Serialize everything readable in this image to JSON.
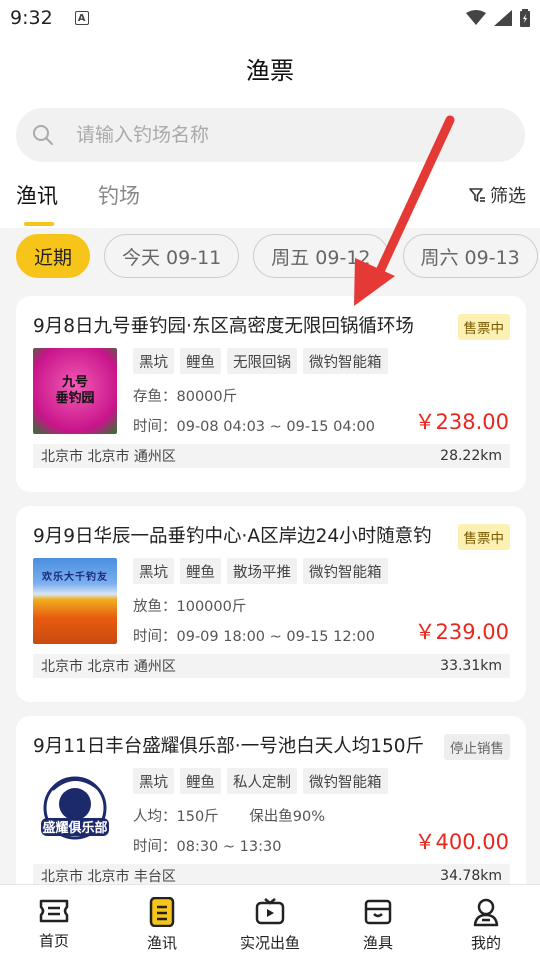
{
  "status": {
    "time": "9:32"
  },
  "header": {
    "title": "渔票"
  },
  "search": {
    "placeholder": "请输入钓场名称"
  },
  "tabs": [
    {
      "label": "渔讯"
    },
    {
      "label": "钓场"
    }
  ],
  "filter": {
    "label": "筛选"
  },
  "dates": [
    {
      "label": "近期"
    },
    {
      "label": "今天 09-11"
    },
    {
      "label": "周五 09-12"
    },
    {
      "label": "周六 09-13"
    }
  ],
  "cards": [
    {
      "title": "9月8日九号垂钓园·东区高密度无限回锅循环场",
      "badge": "售票中",
      "tags": [
        "黑坑",
        "鲤鱼",
        "无限回锅",
        "微钓智能箱"
      ],
      "info1": "存鱼：80000斤",
      "info2": "时间：09-08 04:03 ~ 09-15 04:00",
      "price": "￥238.00",
      "location": "北京市 北京市 通州区",
      "distance": "28.22km",
      "thumb_text": "九号垂钓园"
    },
    {
      "title": "9月9日华辰一品垂钓中心·A区岸边24小时随意钓",
      "badge": "售票中",
      "tags": [
        "黑坑",
        "鲤鱼",
        "散场平推",
        "微钓智能箱"
      ],
      "info1": "放鱼：100000斤",
      "info2": "时间：09-09 18:00 ~ 09-15 12:00",
      "price": "￥239.00",
      "location": "北京市 北京市 通州区",
      "distance": "33.31km",
      "thumb_text": "欢乐大千钓友"
    },
    {
      "title": "9月11日丰台盛耀俱乐部·一号池白天人均150斤",
      "badge": "停止销售",
      "tags": [
        "黑坑",
        "鲤鱼",
        "私人定制",
        "微钓智能箱"
      ],
      "info1": "人均：150斤",
      "info1b": "保出鱼90%",
      "info2": "时间：08:30 ~ 13:30",
      "price": "￥400.00",
      "location": "北京市 北京市 丰台区",
      "distance": "34.78km",
      "thumb_text": "盛耀俱乐部"
    }
  ],
  "nav": [
    {
      "label": "首页",
      "icon": "ticket-icon"
    },
    {
      "label": "渔讯",
      "icon": "document-icon"
    },
    {
      "label": "实况出鱼",
      "icon": "tv-icon"
    },
    {
      "label": "渔具",
      "icon": "box-icon"
    },
    {
      "label": "我的",
      "icon": "person-icon"
    }
  ],
  "colors": {
    "accent": "#f7c51a",
    "price": "#e8281e",
    "arrow": "#e53935"
  }
}
